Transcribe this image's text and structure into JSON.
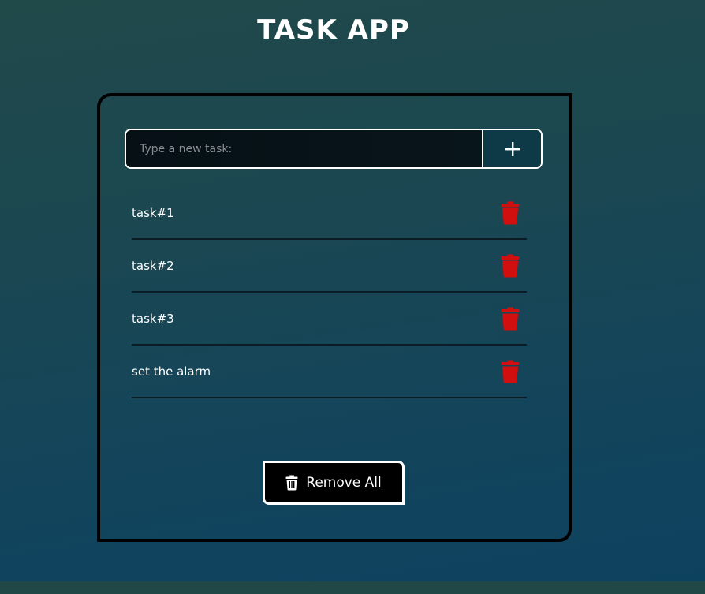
{
  "app": {
    "title": "TASK APP"
  },
  "input": {
    "placeholder": "Type a new task:",
    "value": ""
  },
  "add_button": {
    "icon": "plus-icon"
  },
  "tasks": [
    {
      "text": "task#1",
      "delete_icon": "trash-icon"
    },
    {
      "text": "task#2",
      "delete_icon": "trash-icon"
    },
    {
      "text": "task#3",
      "delete_icon": "trash-icon"
    },
    {
      "text": "set the alarm",
      "delete_icon": "trash-icon"
    }
  ],
  "remove_all": {
    "label": "Remove All",
    "icon": "trash-icon"
  },
  "colors": {
    "background_top": "#20494a",
    "background_bottom": "#0d425f",
    "card_border": "#000000",
    "delete_icon": "#d10f0f",
    "text": "#ffffff"
  }
}
